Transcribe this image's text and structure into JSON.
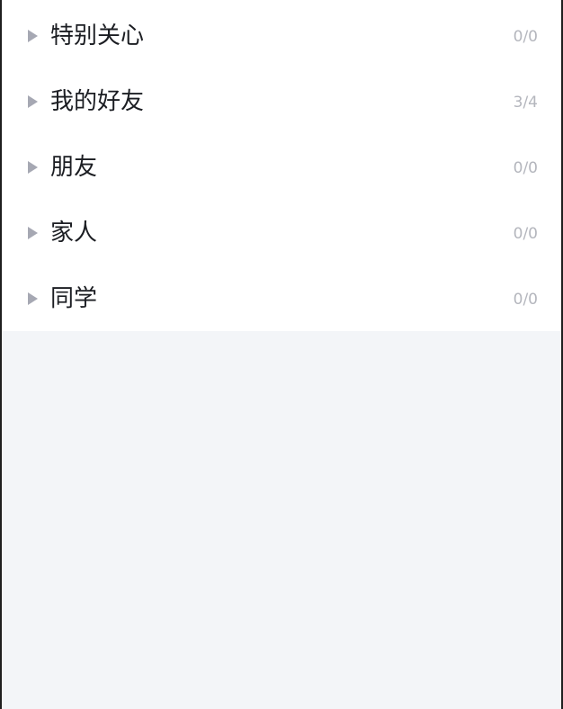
{
  "groups": [
    {
      "name": "特别关心",
      "count": "0/0"
    },
    {
      "name": "我的好友",
      "count": "3/4"
    },
    {
      "name": "朋友",
      "count": "0/0"
    },
    {
      "name": "家人",
      "count": "0/0"
    },
    {
      "name": "同学",
      "count": "0/0"
    }
  ],
  "icons": {
    "collapsed": "caret-right-icon"
  },
  "colors": {
    "list_background": "#ffffff",
    "empty_background": "#f3f5f8",
    "group_name": "#1b1d22",
    "count_text": "#b4b6bd",
    "caret": "#a6a8b3"
  }
}
